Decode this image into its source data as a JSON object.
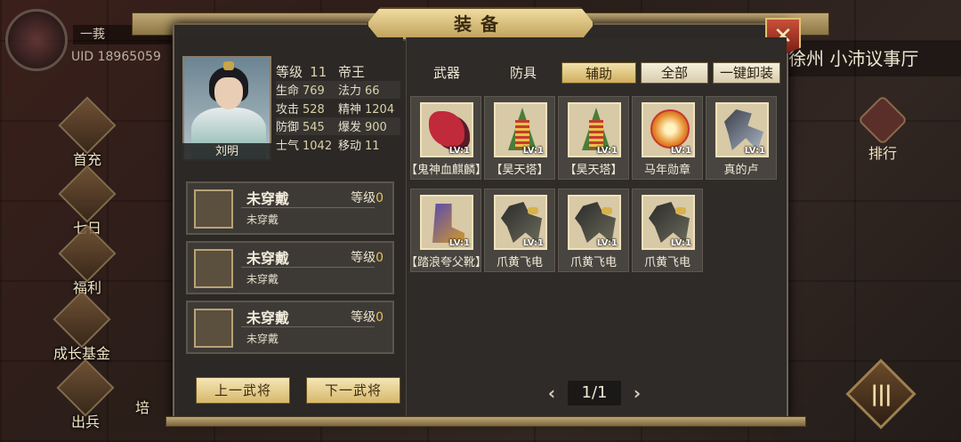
{
  "background": {
    "player_name": "一莪",
    "uid": "UID  18965059",
    "location": "徐州 小沛议事厅",
    "side_menu": [
      "首充",
      "七日",
      "福利",
      "成长基金",
      "出兵",
      "培"
    ],
    "rank_label": "排行",
    "menu_icon": "|||"
  },
  "dialog": {
    "title": "装备",
    "close_icon": "close-icon"
  },
  "hero": {
    "name": "刘明",
    "level_label": "等级",
    "level": "11",
    "rank": "帝王",
    "stats": [
      {
        "label": "生命",
        "value": "769"
      },
      {
        "label": "法力",
        "value": "66"
      },
      {
        "label": "攻击",
        "value": "528"
      },
      {
        "label": "精神",
        "value": "1204"
      },
      {
        "label": "防御",
        "value": "545"
      },
      {
        "label": "爆发",
        "value": "900"
      },
      {
        "label": "士气",
        "value": "1042"
      },
      {
        "label": "移动",
        "value": "11"
      }
    ]
  },
  "slots": [
    {
      "title": "未穿戴",
      "sub": "未穿戴",
      "level_label": "等级",
      "level": "0"
    },
    {
      "title": "未穿戴",
      "sub": "未穿戴",
      "level_label": "等级",
      "level": "0"
    },
    {
      "title": "未穿戴",
      "sub": "未穿戴",
      "level_label": "等级",
      "level": "0"
    }
  ],
  "nav_buttons": {
    "prev": "上一武将",
    "next": "下一武将"
  },
  "tabs": {
    "weapon": "武器",
    "armor": "防具",
    "auxiliary": "辅助",
    "all": "全部",
    "unequip_all": "一键卸装"
  },
  "items": [
    {
      "name": "【鬼神血麒麟】",
      "level": "LV:1",
      "icon": "red-qilin-mount-icon"
    },
    {
      "name": "【昊天塔】",
      "level": "LV:1",
      "icon": "pagoda-icon"
    },
    {
      "name": "【昊天塔】",
      "level": "LV:1",
      "icon": "pagoda-icon"
    },
    {
      "name": "马年勋章",
      "level": "LV:1",
      "icon": "horse-year-medal-icon"
    },
    {
      "name": "真的卢",
      "level": "LV:1",
      "icon": "white-horse-icon"
    },
    {
      "name": "【踏浪夸父靴】",
      "level": "LV:1",
      "icon": "boots-icon"
    },
    {
      "name": "爪黄飞电",
      "level": "LV:1",
      "icon": "black-horse-icon"
    },
    {
      "name": "爪黄飞电",
      "level": "LV:1",
      "icon": "black-horse-icon"
    },
    {
      "name": "爪黄飞电",
      "level": "LV:1",
      "icon": "black-horse-icon"
    }
  ],
  "pager": {
    "prev": "‹",
    "page": "1/1",
    "next": "›"
  },
  "colors": {
    "gold_accent": "#e7c25a",
    "panel_bg": "#2c2926",
    "close_red": "#c7503a"
  }
}
